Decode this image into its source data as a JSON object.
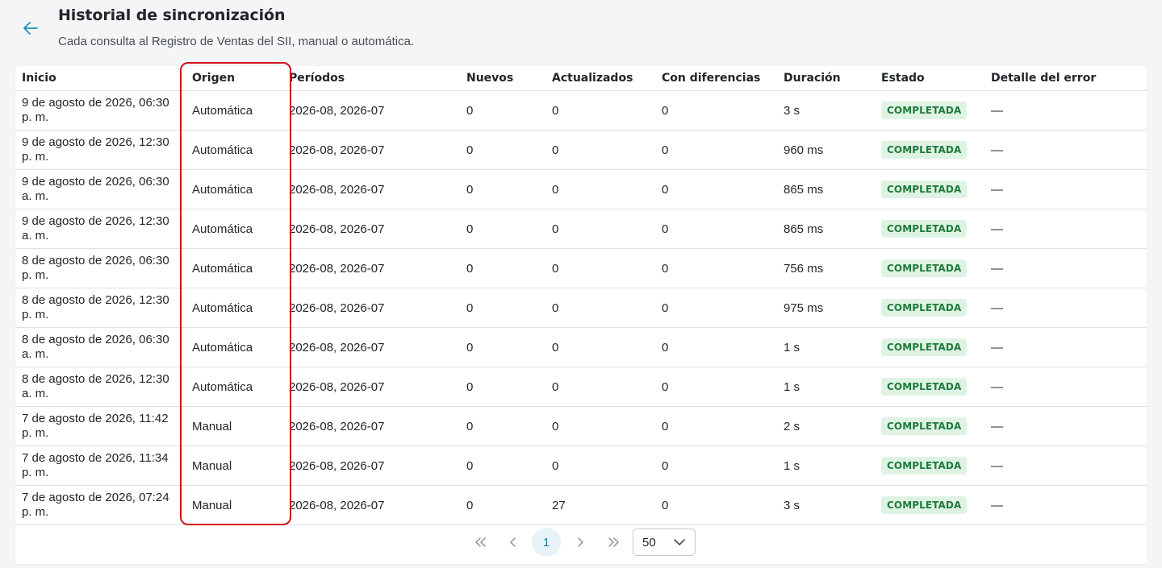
{
  "header": {
    "title": "Historial de sincronización",
    "subtitle": "Cada consulta al Registro de Ventas del SII, manual o automática."
  },
  "table": {
    "columns": [
      "Inicio",
      "Origen",
      "Períodos",
      "Nuevos",
      "Actualizados",
      "Con diferencias",
      "Duración",
      "Estado",
      "Detalle del error"
    ],
    "rows": [
      {
        "inicio": "9 de agosto de 2026, 06:30 p. m.",
        "origen": "Automática",
        "periodos": "2026-08, 2026-07",
        "nuevos": "0",
        "actualizados": "0",
        "diferencias": "0",
        "duracion": "3 s",
        "estado": "COMPLETADA",
        "detalle": "—"
      },
      {
        "inicio": "9 de agosto de 2026, 12:30 p. m.",
        "origen": "Automática",
        "periodos": "2026-08, 2026-07",
        "nuevos": "0",
        "actualizados": "0",
        "diferencias": "0",
        "duracion": "960 ms",
        "estado": "COMPLETADA",
        "detalle": "—"
      },
      {
        "inicio": "9 de agosto de 2026, 06:30 a. m.",
        "origen": "Automática",
        "periodos": "2026-08, 2026-07",
        "nuevos": "0",
        "actualizados": "0",
        "diferencias": "0",
        "duracion": "865 ms",
        "estado": "COMPLETADA",
        "detalle": "—"
      },
      {
        "inicio": "9 de agosto de 2026, 12:30 a. m.",
        "origen": "Automática",
        "periodos": "2026-08, 2026-07",
        "nuevos": "0",
        "actualizados": "0",
        "diferencias": "0",
        "duracion": "865 ms",
        "estado": "COMPLETADA",
        "detalle": "—"
      },
      {
        "inicio": "8 de agosto de 2026, 06:30 p. m.",
        "origen": "Automática",
        "periodos": "2026-08, 2026-07",
        "nuevos": "0",
        "actualizados": "0",
        "diferencias": "0",
        "duracion": "756 ms",
        "estado": "COMPLETADA",
        "detalle": "—"
      },
      {
        "inicio": "8 de agosto de 2026, 12:30 p. m.",
        "origen": "Automática",
        "periodos": "2026-08, 2026-07",
        "nuevos": "0",
        "actualizados": "0",
        "diferencias": "0",
        "duracion": "975 ms",
        "estado": "COMPLETADA",
        "detalle": "—"
      },
      {
        "inicio": "8 de agosto de 2026, 06:30 a. m.",
        "origen": "Automática",
        "periodos": "2026-08, 2026-07",
        "nuevos": "0",
        "actualizados": "0",
        "diferencias": "0",
        "duracion": "1 s",
        "estado": "COMPLETADA",
        "detalle": "—"
      },
      {
        "inicio": "8 de agosto de 2026, 12:30 a. m.",
        "origen": "Automática",
        "periodos": "2026-08, 2026-07",
        "nuevos": "0",
        "actualizados": "0",
        "diferencias": "0",
        "duracion": "1 s",
        "estado": "COMPLETADA",
        "detalle": "—"
      },
      {
        "inicio": "7 de agosto de 2026, 11:42 p. m.",
        "origen": "Manual",
        "periodos": "2026-08, 2026-07",
        "nuevos": "0",
        "actualizados": "0",
        "diferencias": "0",
        "duracion": "2 s",
        "estado": "COMPLETADA",
        "detalle": "—"
      },
      {
        "inicio": "7 de agosto de 2026, 11:34 p. m.",
        "origen": "Manual",
        "periodos": "2026-08, 2026-07",
        "nuevos": "0",
        "actualizados": "0",
        "diferencias": "0",
        "duracion": "1 s",
        "estado": "COMPLETADA",
        "detalle": "—"
      },
      {
        "inicio": "7 de agosto de 2026, 07:24 p. m.",
        "origen": "Manual",
        "periodos": "2026-08, 2026-07",
        "nuevos": "0",
        "actualizados": "27",
        "diferencias": "0",
        "duracion": "3 s",
        "estado": "COMPLETADA",
        "detalle": "—"
      }
    ]
  },
  "pagination": {
    "current_page": "1",
    "rows_per_page": "50",
    "first_icon": "double-chevron-left-icon",
    "prev_icon": "chevron-left-icon",
    "next_icon": "chevron-right-icon",
    "last_icon": "double-chevron-right-icon"
  },
  "colors": {
    "accent": "#1f8fb0",
    "badge_bg": "#dff3e5",
    "badge_text": "#1e7b3a",
    "highlight": "#d0121b"
  }
}
